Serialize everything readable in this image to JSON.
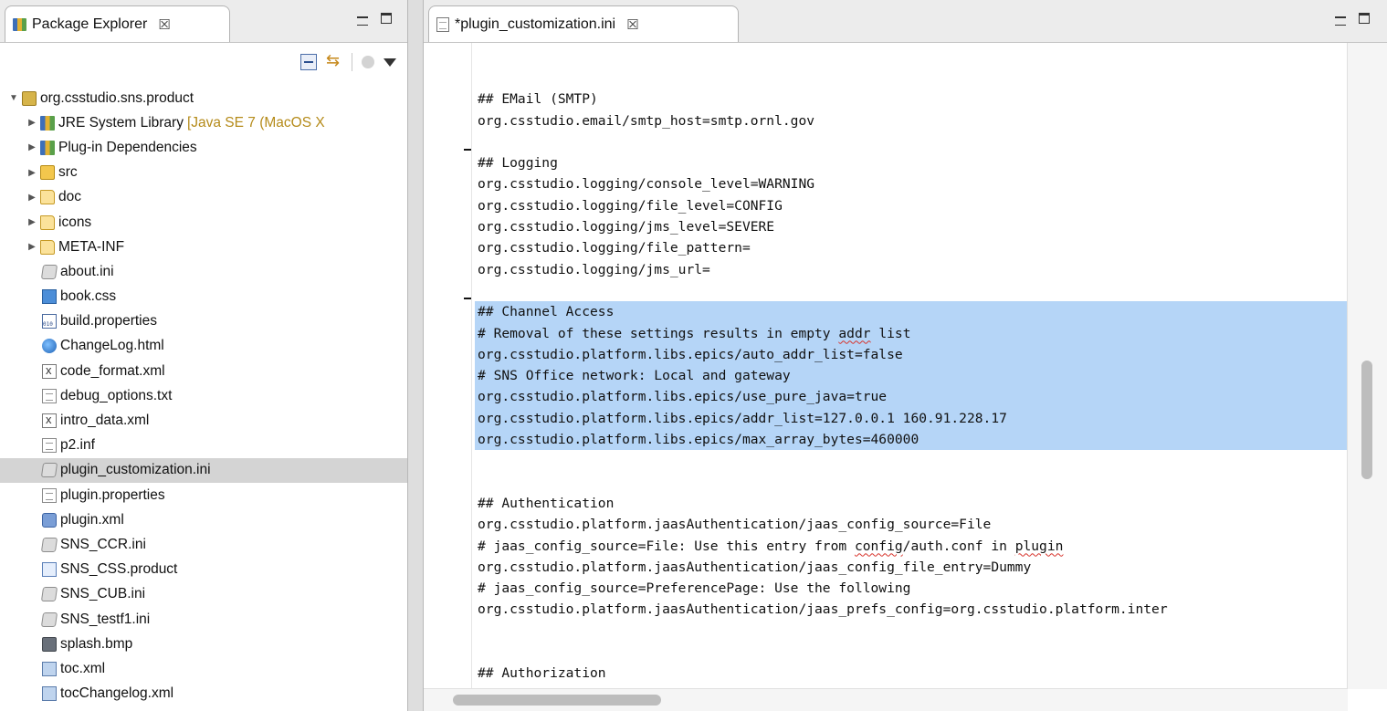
{
  "package_explorer": {
    "title": "Package Explorer",
    "close_glyph": "☒",
    "tree": [
      {
        "label": "org.csstudio.sns.product",
        "icon": "project-icon",
        "twisty": "▼"
      },
      {
        "label": "JRE System Library",
        "decoration": "[Java SE 7 (MacOS X",
        "icon": "library-icon",
        "twisty": "▶"
      },
      {
        "label": "Plug-in Dependencies",
        "icon": "library-icon",
        "twisty": "▶"
      },
      {
        "label": "src",
        "icon": "source-folder-icon",
        "twisty": "▶"
      },
      {
        "label": "doc",
        "icon": "folder-icon",
        "twisty": "▶"
      },
      {
        "label": "icons",
        "icon": "folder-icon",
        "twisty": "▶"
      },
      {
        "label": "META-INF",
        "icon": "folder-icon",
        "twisty": "▶"
      },
      {
        "label": "about.ini",
        "icon": "ini-file-icon"
      },
      {
        "label": "book.css",
        "icon": "css-file-icon"
      },
      {
        "label": "build.properties",
        "icon": "properties-file-icon"
      },
      {
        "label": "ChangeLog.html",
        "icon": "html-file-icon"
      },
      {
        "label": "code_format.xml",
        "icon": "xml-file-icon"
      },
      {
        "label": "debug_options.txt",
        "icon": "text-file-icon"
      },
      {
        "label": "intro_data.xml",
        "icon": "xml-file-icon"
      },
      {
        "label": "p2.inf",
        "icon": "text-file-icon"
      },
      {
        "label": "plugin_customization.ini",
        "icon": "ini-file-icon",
        "selected": true
      },
      {
        "label": "plugin.properties",
        "icon": "text-file-icon"
      },
      {
        "label": "plugin.xml",
        "icon": "plugin-manifest-icon"
      },
      {
        "label": "SNS_CCR.ini",
        "icon": "ini-file-icon"
      },
      {
        "label": "SNS_CSS.product",
        "icon": "product-file-icon"
      },
      {
        "label": "SNS_CUB.ini",
        "icon": "ini-file-icon"
      },
      {
        "label": "SNS_testf1.ini",
        "icon": "ini-file-icon"
      },
      {
        "label": "splash.bmp",
        "icon": "image-file-icon"
      },
      {
        "label": "toc.xml",
        "icon": "toc-file-icon"
      },
      {
        "label": "tocChangelog.xml",
        "icon": "toc-file-icon"
      }
    ]
  },
  "editor": {
    "tab_title": "*plugin_customization.ini",
    "close_glyph": "☒",
    "lines": [
      {
        "text": "",
        "hl": false
      },
      {
        "text": "## EMail (SMTP)",
        "hl": false
      },
      {
        "text": "org.csstudio.email/smtp_host=smtp.ornl.gov",
        "hl": false
      },
      {
        "text": "",
        "hl": false
      },
      {
        "text": "## Logging",
        "hl": false,
        "fold": true
      },
      {
        "text": "org.csstudio.logging/console_level=WARNING",
        "hl": false
      },
      {
        "text": "org.csstudio.logging/file_level=CONFIG",
        "hl": false
      },
      {
        "text": "org.csstudio.logging/jms_level=SEVERE",
        "hl": false
      },
      {
        "text": "org.csstudio.logging/file_pattern=",
        "hl": false
      },
      {
        "text": "org.csstudio.logging/jms_url=",
        "hl": false
      },
      {
        "text": "",
        "hl": false
      },
      {
        "text": "## Channel Access",
        "hl": true,
        "fold": true
      },
      {
        "text": "# Removal of these settings results in empty addr list",
        "hl": true,
        "squiggle": "addr"
      },
      {
        "text": "org.csstudio.platform.libs.epics/auto_addr_list=false",
        "hl": true
      },
      {
        "text": "# SNS Office network: Local and gateway",
        "hl": true
      },
      {
        "text": "org.csstudio.platform.libs.epics/use_pure_java=true",
        "hl": true
      },
      {
        "text": "org.csstudio.platform.libs.epics/addr_list=127.0.0.1 160.91.228.17",
        "hl": true
      },
      {
        "text": "org.csstudio.platform.libs.epics/max_array_bytes=460000",
        "hl": true
      },
      {
        "text": "",
        "hl": false
      },
      {
        "text": "",
        "hl": false
      },
      {
        "text": "## Authentication",
        "hl": false
      },
      {
        "text": "org.csstudio.platform.jaasAuthentication/jaas_config_source=File",
        "hl": false
      },
      {
        "text": "# jaas_config_source=File: Use this entry from config/auth.conf in plugin",
        "hl": false,
        "squiggle": "config|plugin"
      },
      {
        "text": "org.csstudio.platform.jaasAuthentication/jaas_config_file_entry=Dummy",
        "hl": false
      },
      {
        "text": "# jaas_config_source=PreferencePage: Use the following",
        "hl": false
      },
      {
        "text": "org.csstudio.platform.jaasAuthentication/jaas_prefs_config=org.csstudio.platform.inter",
        "hl": false
      },
      {
        "text": "",
        "hl": false
      },
      {
        "text": "",
        "hl": false
      },
      {
        "text": "## Authorization",
        "hl": false
      }
    ]
  }
}
